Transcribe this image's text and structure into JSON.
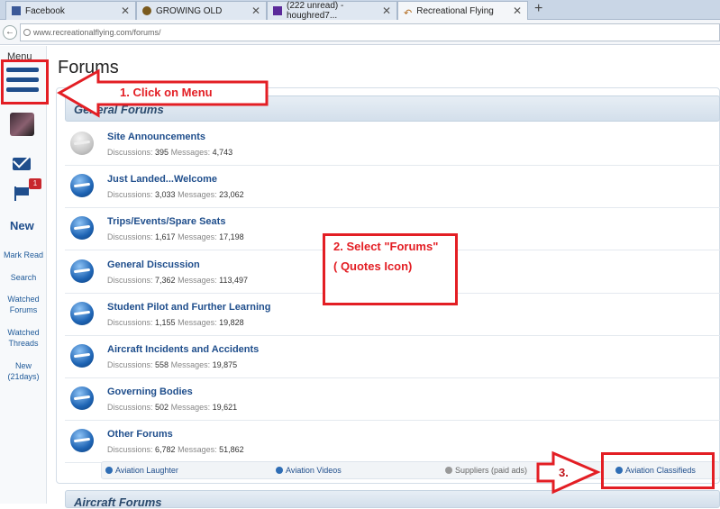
{
  "tabs": [
    {
      "label": "Facebook",
      "icon": "facebook-icon"
    },
    {
      "label": "GROWING OLD",
      "icon": "mask-icon"
    },
    {
      "label": "(222 unread) - houghred7...",
      "icon": "yahoo-mail-icon"
    },
    {
      "label": "Recreational Flying",
      "icon": "recflying-icon",
      "active": true
    }
  ],
  "url": "www.recreationalflying.com/forums/",
  "sidebar": {
    "menu_label": "Menu",
    "notification_count": "1",
    "new_label": "New",
    "links": [
      "Mark Read",
      "Search",
      "Watched\nForums",
      "Watched\nThreads",
      "New (21days)"
    ]
  },
  "page_title": "Forums",
  "category": "General Forums",
  "next_category": "Aircraft Forums",
  "forums": [
    {
      "name": "Site Announcements",
      "discussions": "395",
      "messages": "4,743",
      "read": true
    },
    {
      "name": "Just Landed...Welcome",
      "discussions": "3,033",
      "messages": "23,062"
    },
    {
      "name": "Trips/Events/Spare Seats",
      "discussions": "1,617",
      "messages": "17,198"
    },
    {
      "name": "General Discussion",
      "discussions": "7,362",
      "messages": "113,497"
    },
    {
      "name": "Student Pilot and Further Learning",
      "discussions": "1,155",
      "messages": "19,828"
    },
    {
      "name": "Aircraft Incidents and Accidents",
      "discussions": "558",
      "messages": "19,875"
    },
    {
      "name": "Governing Bodies",
      "discussions": "502",
      "messages": "19,621"
    },
    {
      "name": "Other Forums",
      "discussions": "6,782",
      "messages": "51,862"
    }
  ],
  "labels": {
    "discussions": "Discussions:",
    "messages": "Messages:"
  },
  "subforums": [
    "Aviation Laughter",
    "Aviation Videos",
    "Suppliers (paid ads)",
    "Aviation Classifieds"
  ],
  "annotations": {
    "step1": "1. Click on Menu",
    "step2_line1": "2. Select \"Forums\"",
    "step2_line2": "( Quotes Icon)",
    "step3": "3.",
    "color": "#e31e24"
  }
}
